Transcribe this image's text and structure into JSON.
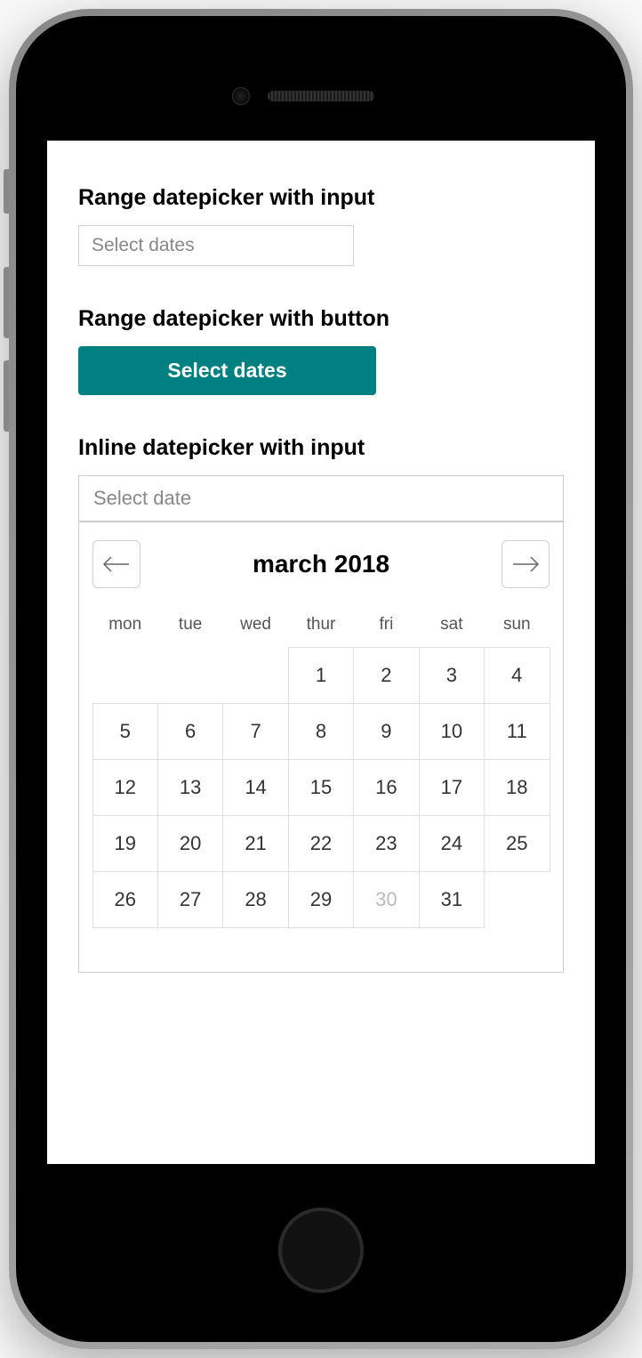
{
  "sections": {
    "rangeInput": {
      "title": "Range datepicker with input",
      "placeholder": "Select dates"
    },
    "rangeButton": {
      "title": "Range datepicker with button",
      "buttonLabel": "Select dates"
    },
    "inline": {
      "title": "Inline datepicker with input",
      "placeholder": "Select date"
    }
  },
  "calendar": {
    "monthTitle": "march 2018",
    "dayHeaders": [
      "mon",
      "tue",
      "wed",
      "thur",
      "fri",
      "sat",
      "sun"
    ],
    "firstDayOffset": 3,
    "daysInMonth": 31,
    "disabledDays": [
      30
    ]
  }
}
